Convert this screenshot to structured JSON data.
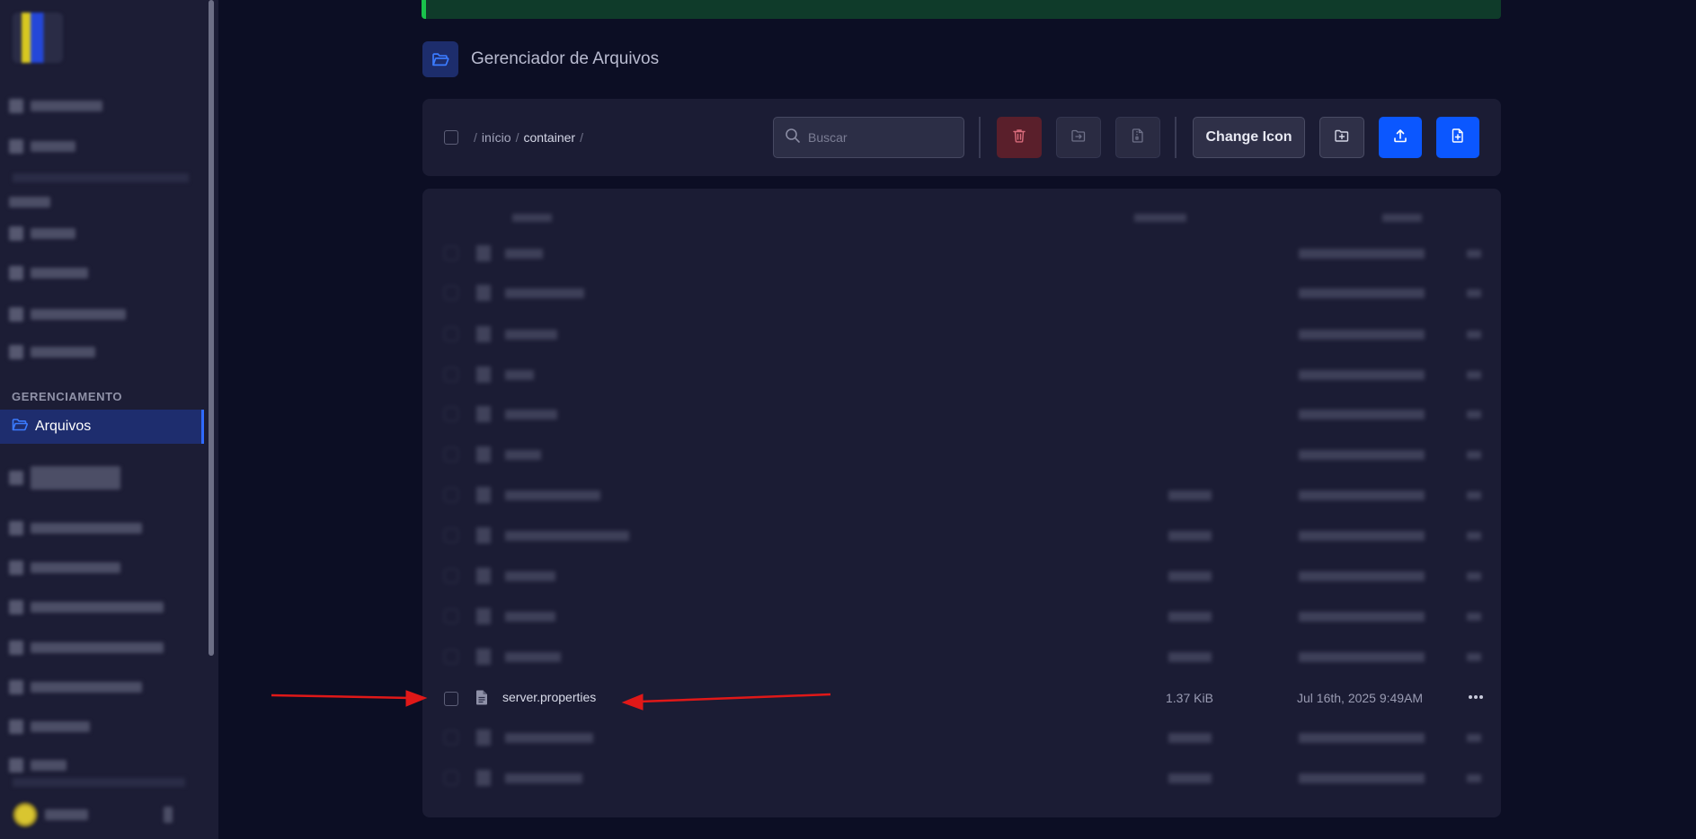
{
  "sidebar": {
    "section_label": "GERENCIAMENTO",
    "active_item": {
      "label": "Arquivos",
      "icon": "folder-open-icon"
    }
  },
  "header": {
    "title": "Gerenciador de Arquivos",
    "icon": "folder-open-icon"
  },
  "breadcrumb": {
    "separator": "/",
    "root": "início",
    "current": "container"
  },
  "search": {
    "placeholder": "Buscar"
  },
  "toolbar": {
    "change_icon_label": "Change Icon",
    "buttons": [
      "trash-icon",
      "folder-move-icon",
      "file-archive-icon",
      "folder-plus-icon",
      "upload-icon",
      "file-plus-icon"
    ]
  },
  "file": {
    "name": "server.properties",
    "size": "1.37 KiB",
    "modified": "Jul 16th, 2025 9:49AM"
  },
  "colors": {
    "accent": "#0b57ff",
    "danger": "#5a1f2b",
    "annotation": "#e01818",
    "success_border": "#19c24b"
  }
}
